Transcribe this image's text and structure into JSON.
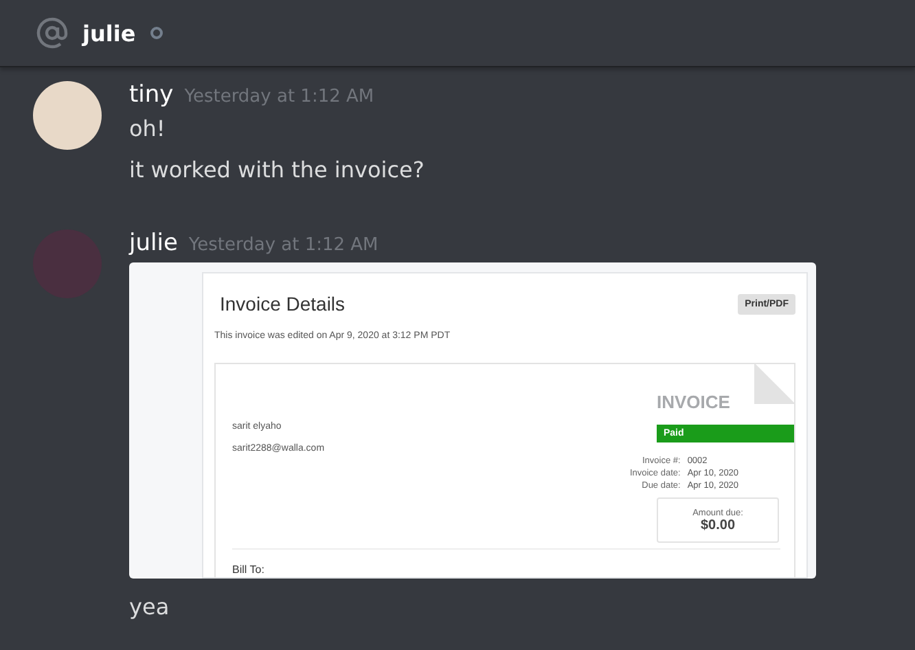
{
  "header": {
    "channel": "julie"
  },
  "messages": [
    {
      "author": "tiny",
      "timestamp": "Yesterday at 1:12 AM",
      "lines": [
        "oh!",
        "it worked with the invoice?"
      ]
    },
    {
      "author": "julie",
      "timestamp": "Yesterday at 1:12 AM",
      "attachment": {
        "title": "Invoice Details",
        "print_button": "Print/PDF",
        "edited_note": "This invoice was edited on Apr 9, 2020 at 3:12 PM PDT",
        "heading": "INVOICE",
        "status": "Paid",
        "sender_name": "sarit elyaho",
        "sender_email": "sarit2288@walla.com",
        "fields": [
          {
            "label": "Invoice #:",
            "value": "0002"
          },
          {
            "label": "Invoice date:",
            "value": "Apr 10, 2020"
          },
          {
            "label": "Due date:",
            "value": "Apr 10, 2020"
          }
        ],
        "amount_label": "Amount due:",
        "amount": "$0.00",
        "bill_to": "Bill To:"
      },
      "lines": [
        "yea"
      ]
    }
  ]
}
